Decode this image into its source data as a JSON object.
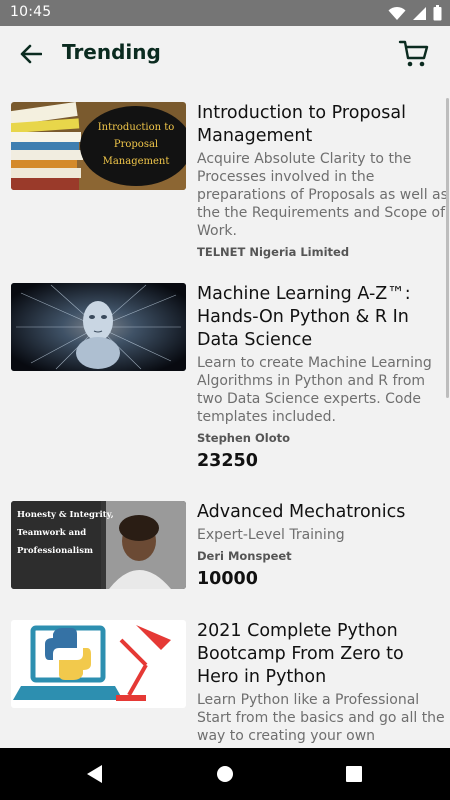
{
  "status": {
    "time": "10:45"
  },
  "header": {
    "title": "Trending"
  },
  "courses": [
    {
      "title": "Introduction to Proposal Management",
      "thumb_caption_line1": "Introduction to",
      "thumb_caption_line2": "Proposal",
      "thumb_caption_line3": "Management",
      "description": "Acquire Absolute Clarity to the Processes involved in the preparations of Proposals as well as the the Requirements and Scope of Work.",
      "author": "TELNET  Nigeria Limited",
      "price": ""
    },
    {
      "title": "Machine Learning A-Z™: Hands-On Python & R In Data Science",
      "description": "Learn to create Machine Learning Algorithms in Python and R from two Data Science experts. Code templates included.",
      "author": "Stephen Oloto",
      "price": "23250"
    },
    {
      "title": "Advanced Mechatronics",
      "thumb_caption_line1": "Honesty & Integrity,",
      "thumb_caption_line2": "Teamwork and",
      "thumb_caption_line3": "Professionalism",
      "description": "Expert-Level Training",
      "author": "Deri Monspeet",
      "price": "10000"
    },
    {
      "title": "2021 Complete Python Bootcamp From Zero to Hero in Python",
      "description": "Learn Python like a Professional  Start from the basics and go all the way to creating your own",
      "author": "",
      "price": ""
    }
  ],
  "icons": {
    "back": "arrow-back-icon",
    "cart": "cart-icon",
    "wifi": "wifi-icon",
    "signal": "signal-icon",
    "battery": "battery-icon",
    "nav_back": "nav-back-icon",
    "nav_home": "nav-home-icon",
    "nav_recents": "nav-recents-icon"
  },
  "colors": {
    "title": "#0b2b20",
    "status_bar": "#757575",
    "background": "#f2f2f2"
  }
}
